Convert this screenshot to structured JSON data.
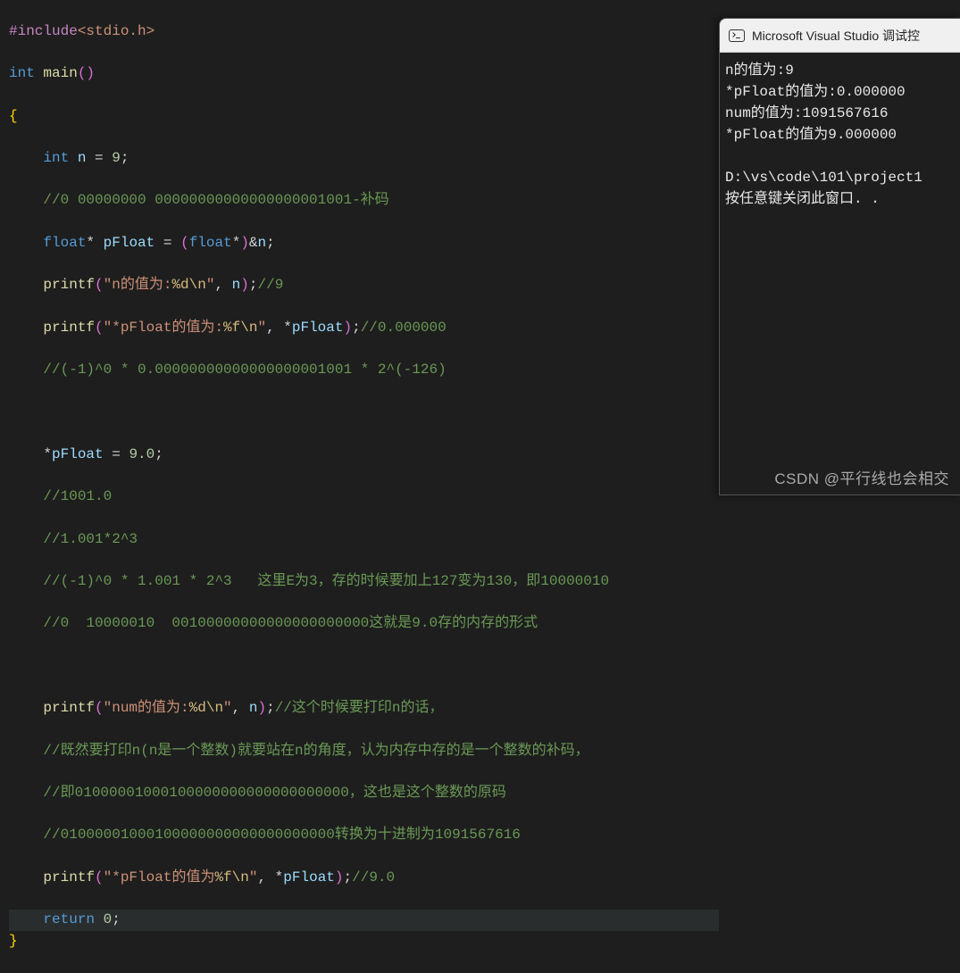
{
  "code": {
    "l1_preproc": "#include",
    "l1_path": "<stdio.h>",
    "l2_type": "int",
    "l2_func": "main",
    "l3_brace": "{",
    "l4_type": "int",
    "l4_var": "n",
    "l4_op": "=",
    "l4_num": "9",
    "l5_comment": "//0 00000000 00000000000000000001001-补码",
    "l6_type1": "float",
    "l6_var1": "pFloat",
    "l6_op": "=",
    "l6_type2": "float",
    "l6_var2": "n",
    "l7_func": "printf",
    "l7_str": "\"n的值为:",
    "l7_fmt": "%d\\n",
    "l7_strend": "\"",
    "l7_var": "n",
    "l7_comment": "//9",
    "l8_func": "printf",
    "l8_str": "\"*pFloat的值为:",
    "l8_fmt": "%f\\n",
    "l8_strend": "\"",
    "l8_var": "pFloat",
    "l8_comment": "//0.000000",
    "l9_comment": "//(-1)^0 * 0.00000000000000000001001 * 2^(-126)",
    "l11_var": "pFloat",
    "l11_op": "=",
    "l11_num": "9.0",
    "l12_comment": "//1001.0",
    "l13_comment": "//1.001*2^3",
    "l14_comment": "//(-1)^0 * 1.001 * 2^3   这里E为3，存的时候要加上127变为130，即10000010",
    "l15_comment": "//0  10000010  00100000000000000000000这就是9.0存的内存的形式",
    "l17_func": "printf",
    "l17_str": "\"num的值为:",
    "l17_fmt": "%d\\n",
    "l17_strend": "\"",
    "l17_var": "n",
    "l17_comment": "//这个时候要打印n的话，",
    "l18_comment": "//既然要打印n(n是一个整数)就要站在n的角度，认为内存中存的是一个整数的补码，",
    "l19_comment": "//即01000001000100000000000000000000，这也是这个整数的原码",
    "l20_comment": "//01000001000100000000000000000000转换为十进制为1091567616",
    "l21_func": "printf",
    "l21_str": "\"*pFloat的值为",
    "l21_fmt": "%f\\n",
    "l21_strend": "\"",
    "l21_var": "pFloat",
    "l21_comment": "//9.0",
    "l22_return": "return",
    "l22_num": "0",
    "l23_brace": "}"
  },
  "console": {
    "title": "Microsoft Visual Studio 调试控",
    "out1": "n的值为:9",
    "out2": "*pFloat的值为:0.000000",
    "out3": "num的值为:1091567616",
    "out4": "*pFloat的值为9.000000",
    "path": "D:\\vs\\code\\101\\project1",
    "prompt": "按任意键关闭此窗口. ."
  },
  "watermark": "CSDN @平行线也会相交"
}
